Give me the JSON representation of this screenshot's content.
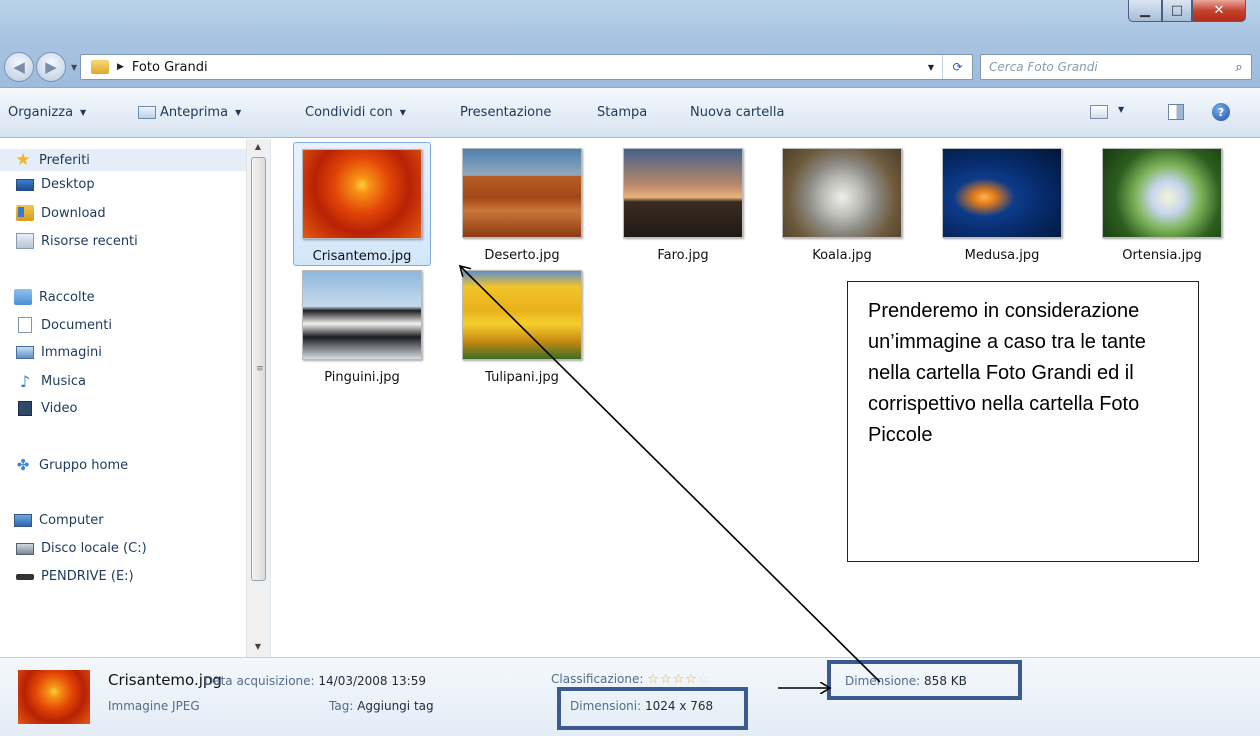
{
  "window": {
    "breadcrumb": "Foto Grandi",
    "search_placeholder": "Cerca Foto Grandi",
    "controls": [
      "minimize-icon",
      "maximize-icon",
      "close-icon"
    ]
  },
  "toolbar": {
    "organize": "Organizza",
    "preview": "Anteprima",
    "share": "Condividi con",
    "slideshow": "Presentazione",
    "print": "Stampa",
    "new_folder": "Nuova cartella"
  },
  "sidebar": {
    "favorites": "Preferiti",
    "desktop": "Desktop",
    "download": "Download",
    "recent": "Risorse recenti",
    "libraries": "Raccolte",
    "documents": "Documenti",
    "images": "Immagini",
    "music": "Musica",
    "video": "Video",
    "homegroup": "Gruppo home",
    "computer": "Computer",
    "local_disk": "Disco locale (C:)",
    "pendrive": "PENDRIVE (E:)"
  },
  "files": [
    {
      "name": "Crisantemo.jpg",
      "selected": true
    },
    {
      "name": "Deserto.jpg"
    },
    {
      "name": "Faro.jpg"
    },
    {
      "name": "Koala.jpg"
    },
    {
      "name": "Medusa.jpg"
    },
    {
      "name": "Ortensia.jpg"
    },
    {
      "name": "Pinguini.jpg"
    },
    {
      "name": "Tulipani.jpg"
    }
  ],
  "annotation": {
    "text": "Prenderemo in considerazione un’immagine a caso tra le tante nella cartella Foto Grandi ed il corrispettivo nella cartella Foto Piccole"
  },
  "details": {
    "file_name": "Crisantemo.jpg",
    "file_type": "Immagine JPEG",
    "date_label": "Data acquisizione:",
    "date_value": "14/03/2008 13:59",
    "tag_label": "Tag:",
    "tag_value": "Aggiungi tag",
    "rating_label": "Classificazione:",
    "rating": 0,
    "dimensions_label": "Dimensioni:",
    "dimensions_value": "1024 x 768",
    "size_label": "Dimensione:",
    "size_value": "858 KB"
  },
  "colors": {
    "highlight_box": "#3b5b8e",
    "selection": "#d2e6fb"
  }
}
